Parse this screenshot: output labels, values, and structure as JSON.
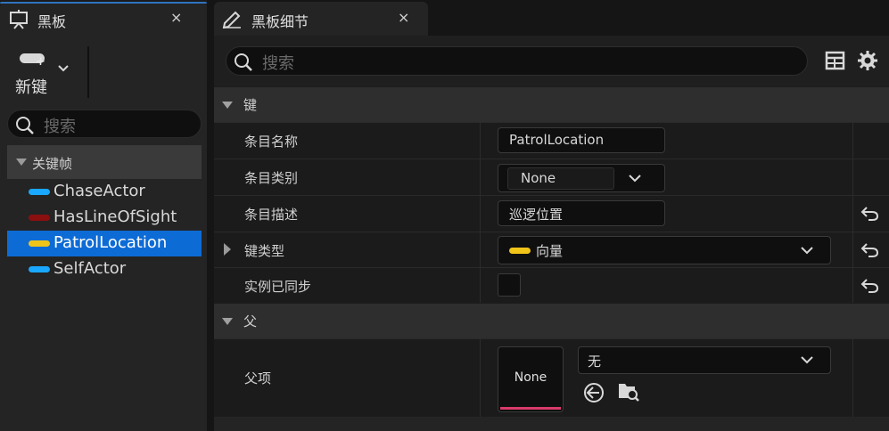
{
  "blackboard_tab": {
    "title": "黑板",
    "close": "×"
  },
  "new_key": {
    "label": "新键"
  },
  "left_search": {
    "placeholder": "搜索"
  },
  "keyframes_header": {
    "label": "关键帧"
  },
  "keys": [
    {
      "name": "ChaseActor",
      "color": "#1aa7ff",
      "selected": false
    },
    {
      "name": "HasLineOfSight",
      "color": "#8b0f0f",
      "selected": false
    },
    {
      "name": "PatrolLocation",
      "color": "#f0c419",
      "selected": true
    },
    {
      "name": "SelfActor",
      "color": "#1aa7ff",
      "selected": false
    }
  ],
  "details_tab": {
    "title": "黑板细节",
    "close": "×"
  },
  "right_search": {
    "placeholder": "搜索"
  },
  "section_key": {
    "label": "键"
  },
  "rows": {
    "entry_name": {
      "label": "条目名称",
      "value": "PatrolLocation"
    },
    "entry_category": {
      "label": "条目类别",
      "value": "None"
    },
    "entry_description": {
      "label": "条目描述",
      "value": "巡逻位置"
    },
    "key_type": {
      "label": "键类型",
      "value": "向量",
      "color": "#f0c419"
    },
    "instance_synced": {
      "label": "实例已同步",
      "checked": false
    }
  },
  "section_parent": {
    "label": "父"
  },
  "parent_item": {
    "label": "父项",
    "thumbnail": "None",
    "value": "无"
  }
}
